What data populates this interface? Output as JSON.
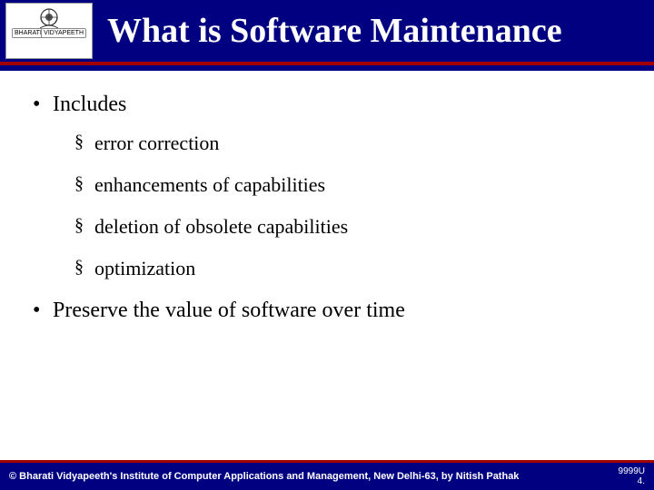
{
  "header": {
    "title": "What is Software Maintenance",
    "logo": {
      "left_label": "BHARATI",
      "right_label": "VIDYAPEETH"
    }
  },
  "body": {
    "bullets": [
      {
        "text": "Includes",
        "sub": [
          "error correction",
          "enhancements of capabilities",
          "deletion of obsolete capabilities",
          "optimization"
        ]
      },
      {
        "text": "Preserve the value of software over time",
        "sub": []
      }
    ]
  },
  "footer": {
    "copyright": "© Bharati Vidyapeeth's Institute of Computer Applications and Management, New Delhi-63, by  Nitish Pathak",
    "right_top": "9999U",
    "right_bottom": "4."
  }
}
